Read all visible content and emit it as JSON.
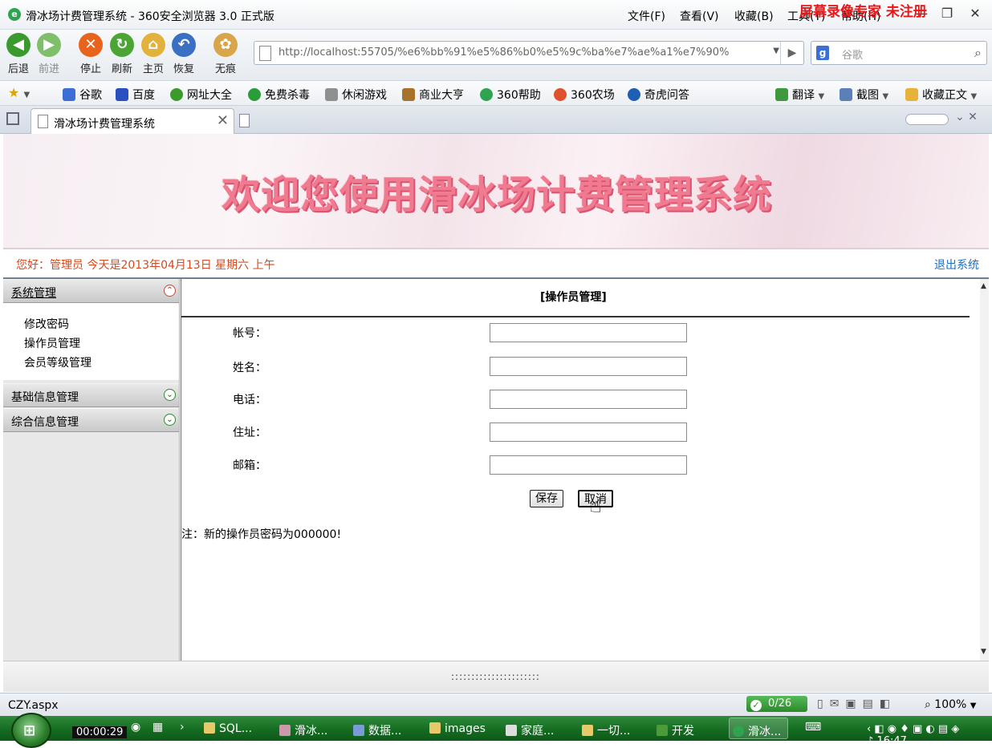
{
  "window": {
    "title": "滑冰场计费管理系统 - 360安全浏览器 3.0 正式版",
    "menu": [
      "文件(F)",
      "查看(V)",
      "收藏(B)",
      "工具(T)",
      "帮助(H)"
    ],
    "watermark": "屏幕录像专家  未注册"
  },
  "toolbar": {
    "buttons": [
      {
        "label": "后退",
        "color": "#3b9a2e"
      },
      {
        "label": "前进",
        "color": "#7fbf6a"
      },
      {
        "label": "停止",
        "color": "#e8641c"
      },
      {
        "label": "刷新",
        "color": "#4ba535"
      },
      {
        "label": "主页",
        "color": "#e3b23c"
      },
      {
        "label": "恢复",
        "color": "#3a6fc4"
      },
      {
        "label": "无痕",
        "color": "#d9a54a"
      }
    ],
    "url": "http://localhost:55705/%e6%bb%91%e5%86%b0%e5%9c%ba%e7%ae%a1%e7%90%",
    "search_placeholder": "谷歌"
  },
  "favorites": {
    "items": [
      "谷歌",
      "百度",
      "网址大全",
      "免费杀毒",
      "休闲游戏",
      "商业大亨",
      "360帮助",
      "360农场",
      "奇虎问答"
    ],
    "right": [
      "翻译",
      "截图",
      "收藏正文"
    ]
  },
  "tab": {
    "title": "滑冰场计费管理系统"
  },
  "page": {
    "banner": "欢迎您使用滑冰场计费管理系统",
    "greeting": "您好：管理员   今天是2013年04月13日   星期六   上午",
    "logout": "退出系统",
    "sidebar": {
      "sections": [
        {
          "title": "系统管理",
          "items": [
            "修改密码",
            "操作员管理",
            "会员等级管理"
          ]
        },
        {
          "title": "基础信息管理"
        },
        {
          "title": "综合信息管理"
        }
      ]
    },
    "form": {
      "title": "[操作员管理]",
      "fields": [
        {
          "label": "帐号：",
          "value": ""
        },
        {
          "label": "姓名：",
          "value": ""
        },
        {
          "label": "电话：",
          "value": ""
        },
        {
          "label": "住址：",
          "value": ""
        },
        {
          "label": "邮箱：",
          "value": ""
        }
      ],
      "save": "保存",
      "cancel": "取消",
      "note": "注：新的操作员密码为000000!"
    }
  },
  "statusbar": {
    "url": "CZY.aspx",
    "counter": "0/26",
    "zoom": "100%"
  },
  "taskbar": {
    "timer": "00:00:29",
    "items": [
      "SQL...",
      "滑冰...",
      "数据...",
      "images",
      "家庭...",
      "一切...",
      "开发",
      "滑冰..."
    ],
    "clock": "16:47"
  }
}
